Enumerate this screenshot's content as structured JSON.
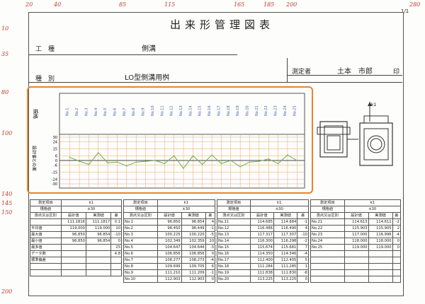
{
  "ruler_top": [
    "20",
    "40",
    "85",
    "115",
    "165",
    "185",
    "200",
    "280"
  ],
  "ruler_left": [
    "10",
    "35",
    "80",
    "100",
    "140",
    "145",
    "150",
    "200",
    "20"
  ],
  "page_num": "1/1",
  "title": "出来形管理図表",
  "kouji_label": "工　種",
  "kouji_value": "側溝",
  "shubetsu_label": "種　別",
  "shubetsu_value": "LO型側溝用桝",
  "measurer_label": "測定者",
  "measurer_name": "土本　市郎",
  "seal": "印",
  "chart_data": {
    "type": "line",
    "ylabel_top": "規格",
    "ylabel_bottom": "設計値との差",
    "x_labels": [
      "No.1",
      "No.2",
      "No.3",
      "No.4",
      "No.5",
      "No.6",
      "No.7",
      "No.8",
      "No.9",
      "No.10",
      "No.11",
      "No.12",
      "No.13",
      "No.14",
      "No.15",
      "No.16",
      "No.17",
      "No.18",
      "No.19",
      "No.20",
      "No.21",
      "No.22",
      "No.23",
      "No.24",
      "No.25"
    ],
    "yticks": [
      "30",
      "24",
      "15",
      "6",
      "0",
      "-6",
      "-15",
      "-24",
      "-30"
    ],
    "values": [
      4,
      -1,
      -5,
      10,
      -3,
      -2,
      -7,
      -2,
      -1,
      0,
      -4,
      6,
      -10,
      6,
      -5,
      7,
      -4,
      0,
      -8,
      -2,
      -1,
      2,
      -4,
      7,
      0
    ],
    "ylim": [
      -30,
      30
    ],
    "diagram_label": "k1"
  },
  "blocks": [
    {
      "head": [
        "測定項目",
        "k1",
        "規格値",
        "±30",
        "測点又は区別",
        "設計値",
        "実測値",
        "差"
      ],
      "rows": [
        [
          "",
          "111.1816",
          "111.1817",
          "0.1"
        ],
        [
          "平均値",
          "119.000",
          "119.000",
          "10"
        ],
        [
          "最大値",
          "96.850",
          "96.854",
          "-10"
        ],
        [
          "最小値",
          "96.850",
          "96.854",
          "0"
        ],
        [
          "最多値",
          "",
          "",
          "25"
        ],
        [
          "データ数",
          "",
          "",
          "4.8"
        ],
        [
          "標準偏差",
          "",
          "",
          ""
        ],
        [
          "",
          "",
          "",
          ""
        ],
        [
          "",
          "",
          "",
          ""
        ]
      ]
    },
    {
      "head": [
        "測定項目",
        "k1",
        "規格値",
        "±30",
        "測点又は区別",
        "設計値",
        "実測値",
        "差"
      ],
      "rows": [
        [
          "No.1",
          "96.850",
          "96.854",
          "4"
        ],
        [
          "No.2",
          "98.450",
          "98.449",
          "-1"
        ],
        [
          "No.3",
          "100.225",
          "100.220",
          "-5"
        ],
        [
          "No.4",
          "102.349",
          "102.359",
          "10"
        ],
        [
          "No.5",
          "104.647",
          "104.644",
          "-3"
        ],
        [
          "No.6",
          "106.856",
          "106.856",
          "0"
        ],
        [
          "No.7",
          "108.277",
          "108.273",
          "-4"
        ],
        [
          "No.8",
          "109.699",
          "109.705",
          "6"
        ],
        [
          "No.9",
          "111.210",
          "111.209",
          "-1"
        ],
        [
          "No.10",
          "112.903",
          "112.903",
          "0"
        ]
      ]
    },
    {
      "head": [
        "測定項目",
        "k1",
        "規格値",
        "±30",
        "測点又は区別",
        "設計値",
        "実測値",
        "差"
      ],
      "rows": [
        [
          "No.11",
          "114.685",
          "114.684",
          "-1"
        ],
        [
          "No.12",
          "116.486",
          "116.490",
          "4"
        ],
        [
          "No.13",
          "117.317",
          "117.307",
          "-10"
        ],
        [
          "No.14",
          "116.300",
          "116.298",
          "-2"
        ],
        [
          "No.15",
          "115.674",
          "115.681",
          "7"
        ],
        [
          "No.16",
          "114.350",
          "114.346",
          "-4"
        ],
        [
          "No.17",
          "112.400",
          "112.405",
          "5"
        ],
        [
          "No.18",
          "111.284",
          "111.285",
          "1"
        ],
        [
          "No.19",
          "111.838",
          "111.830",
          "-8"
        ],
        [
          "No.20",
          "113.225",
          "113.225",
          "0"
        ]
      ]
    },
    {
      "head": [
        "測定項目",
        "k1",
        "規格値",
        "±30",
        "測点又は区別",
        "設計値",
        "実測値",
        "差"
      ],
      "rows": [
        [
          "No.21",
          "114.613",
          "114.611",
          "-2"
        ],
        [
          "No.22",
          "115.903",
          "115.905",
          "2"
        ],
        [
          "No.23",
          "117.000",
          "116.996",
          "-4"
        ],
        [
          "No.24",
          "118.000",
          "118.000",
          "0"
        ],
        [
          "No.25",
          "119.000",
          "119.000",
          "0"
        ],
        [
          "",
          "",
          "",
          ""
        ],
        [
          "",
          "",
          "",
          ""
        ],
        [
          "",
          "",
          "",
          ""
        ],
        [
          "",
          "",
          "",
          ""
        ],
        [
          "",
          "",
          "",
          ""
        ]
      ]
    }
  ]
}
